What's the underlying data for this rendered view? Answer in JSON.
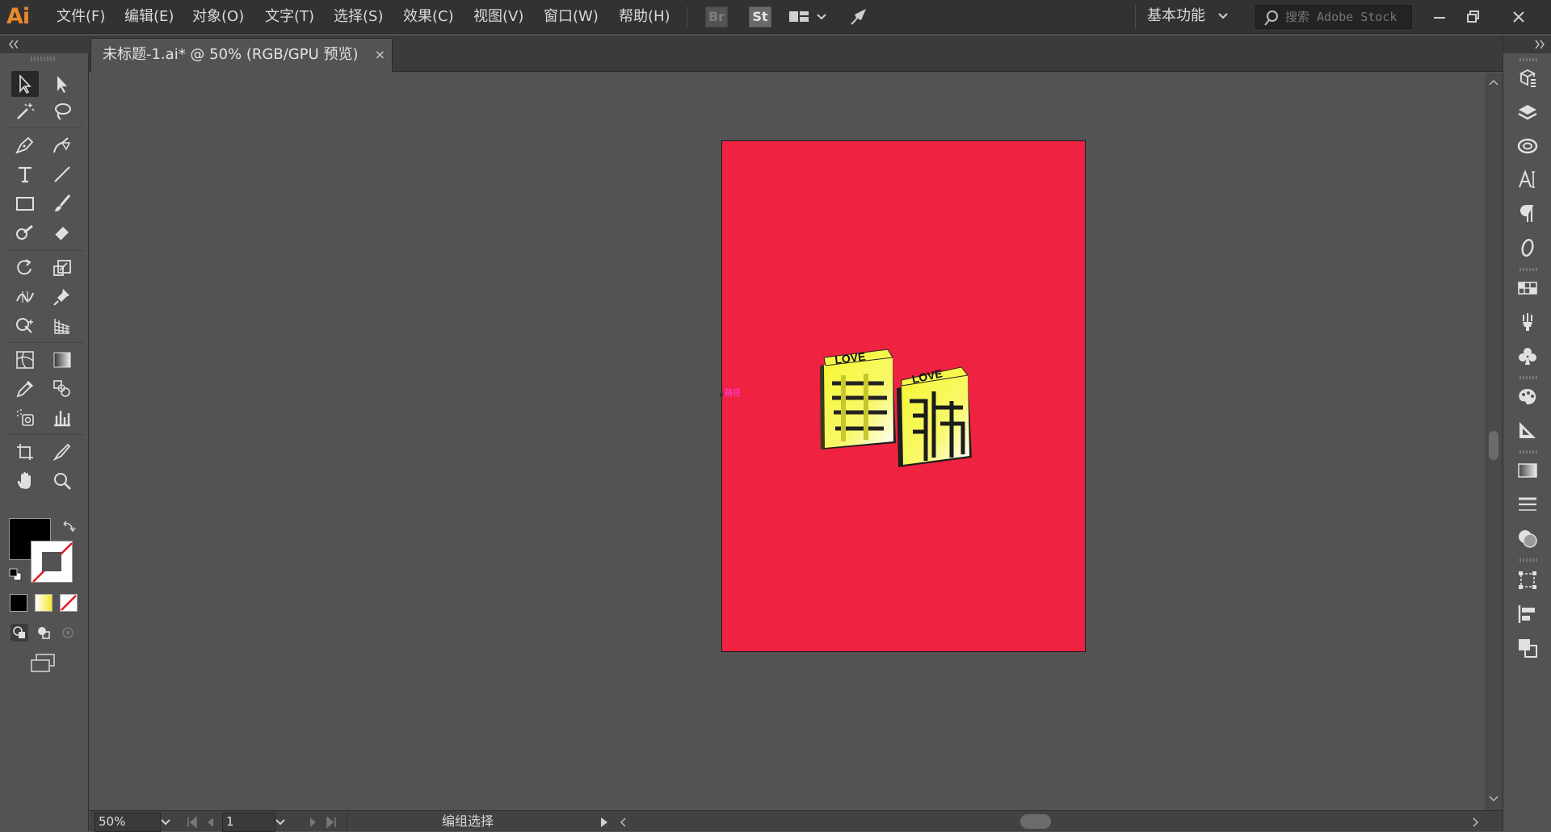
{
  "app": {
    "logo": "Ai"
  },
  "menu": [
    {
      "id": "file",
      "label": "文件(F)"
    },
    {
      "id": "edit",
      "label": "编辑(E)"
    },
    {
      "id": "object",
      "label": "对象(O)"
    },
    {
      "id": "type",
      "label": "文字(T)"
    },
    {
      "id": "select",
      "label": "选择(S)"
    },
    {
      "id": "effect",
      "label": "效果(C)"
    },
    {
      "id": "view",
      "label": "视图(V)"
    },
    {
      "id": "window",
      "label": "窗口(W)"
    },
    {
      "id": "help",
      "label": "帮助(H)"
    }
  ],
  "topbar": {
    "bridge_label": "Br",
    "stock_label": "St",
    "workspace_label": "基本功能",
    "search_placeholder": "搜索 Adobe Stock"
  },
  "document": {
    "tab_title": "未标题-1.ai* @ 50% (RGB/GPU 预览)",
    "tab_close": "×",
    "artboard_color": "#ef2341",
    "path_label": "路径"
  },
  "artwork": {
    "left_block_text": "LOVE",
    "left_block_char": "喜",
    "right_block_text": "LOVE",
    "right_block_char": "歡",
    "fill_color": "#f5f53c"
  },
  "status": {
    "zoom": "50%",
    "page": "1",
    "mode": "编组选择"
  },
  "colors": {
    "accent_logo": "#e8892c",
    "ui_dark": "#323232",
    "ui_mid": "#535353"
  }
}
